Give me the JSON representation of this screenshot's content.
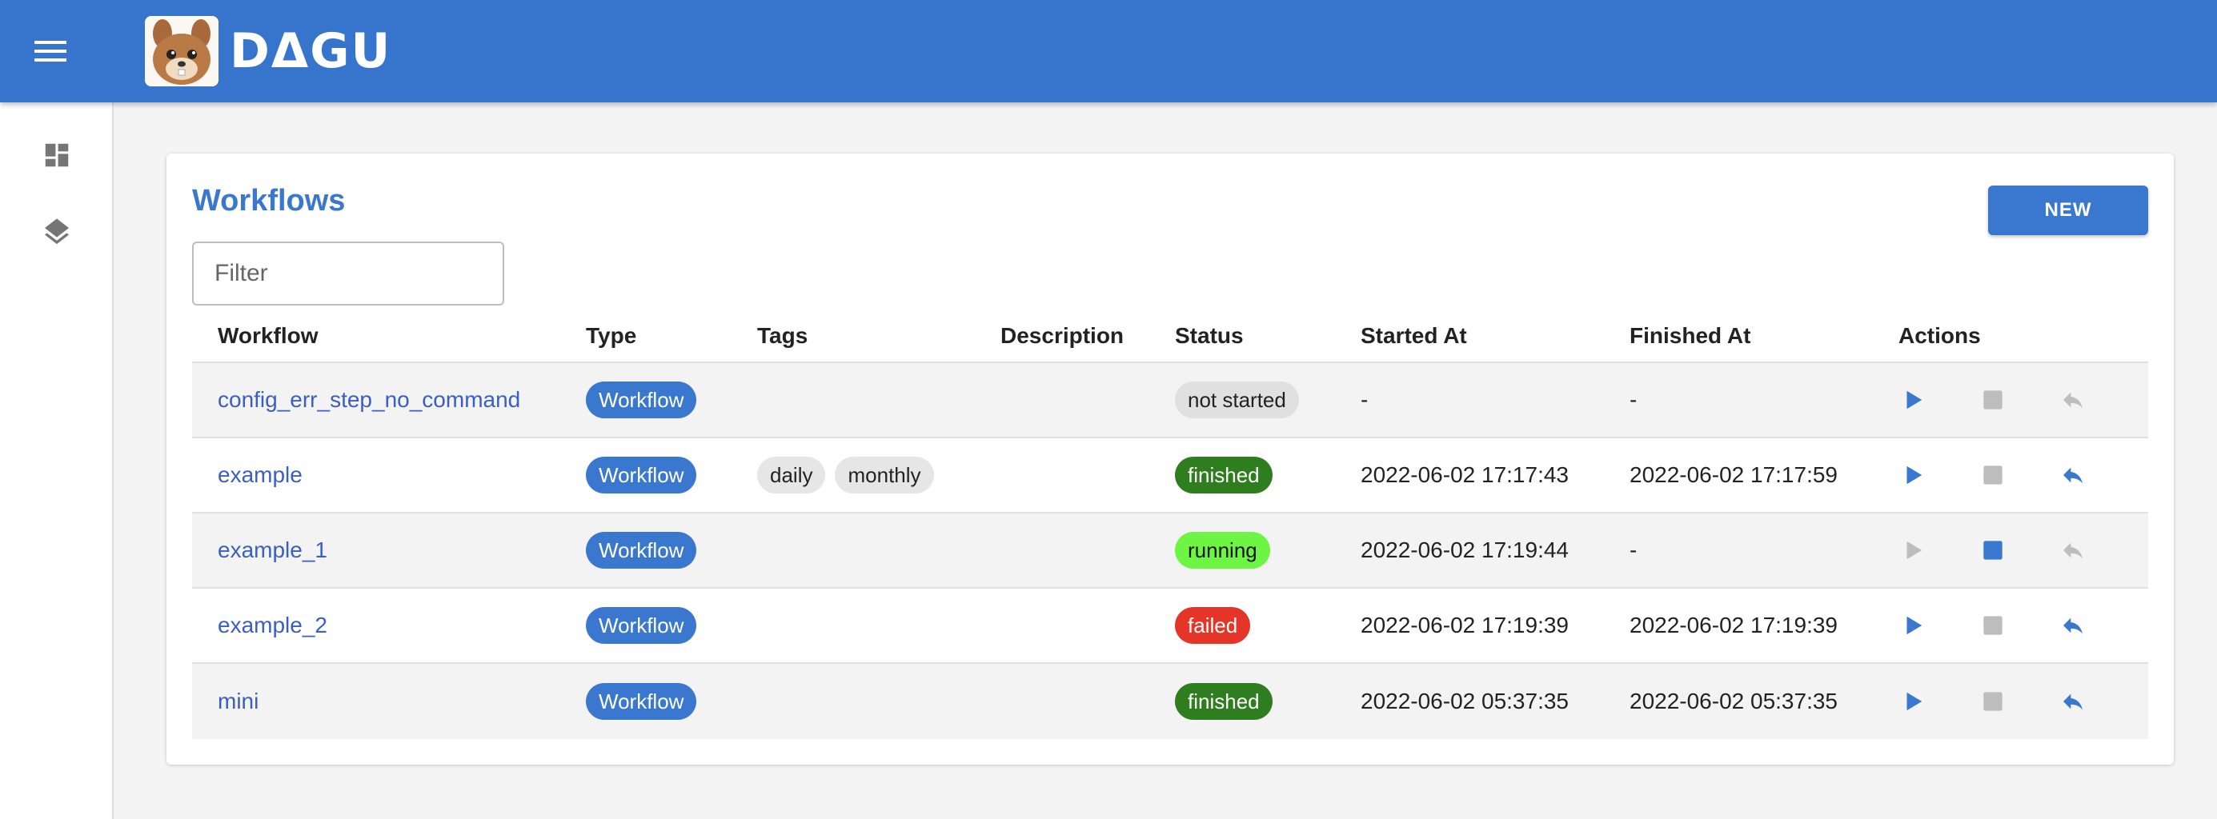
{
  "app": {
    "logo_text": "DΔGU"
  },
  "colors": {
    "primary": "#3775cd",
    "link": "#3b5fc0",
    "icon_enabled": "#3a78cf",
    "icon_disabled": "#bdbdbd",
    "status_not_started": "#e0e0e0",
    "status_finished": "#2e7d1e",
    "status_running": "#6cf542",
    "status_failed": "#e53529"
  },
  "sidebar": {
    "items": [
      {
        "icon": "dashboard-icon"
      },
      {
        "icon": "layers-icon"
      }
    ]
  },
  "main": {
    "title": "Workflows",
    "new_button": "NEW",
    "filter_placeholder": "Filter",
    "filter_value": ""
  },
  "table": {
    "headers": {
      "workflow": "Workflow",
      "type": "Type",
      "tags": "Tags",
      "description": "Description",
      "status": "Status",
      "started_at": "Started At",
      "finished_at": "Finished At",
      "actions": "Actions"
    },
    "rows": [
      {
        "name": "config_err_step_no_command",
        "type": "Workflow",
        "tags": [],
        "description": "",
        "status": "not started",
        "started_at": "-",
        "finished_at": "-",
        "actions": {
          "start": true,
          "stop": false,
          "retry": false
        }
      },
      {
        "name": "example",
        "type": "Workflow",
        "tags": [
          "daily",
          "monthly"
        ],
        "description": "",
        "status": "finished",
        "started_at": "2022-06-02 17:17:43",
        "finished_at": "2022-06-02 17:17:59",
        "actions": {
          "start": true,
          "stop": false,
          "retry": true
        }
      },
      {
        "name": "example_1",
        "type": "Workflow",
        "tags": [],
        "description": "",
        "status": "running",
        "started_at": "2022-06-02 17:19:44",
        "finished_at": "-",
        "actions": {
          "start": false,
          "stop": true,
          "retry": false
        }
      },
      {
        "name": "example_2",
        "type": "Workflow",
        "tags": [],
        "description": "",
        "status": "failed",
        "started_at": "2022-06-02 17:19:39",
        "finished_at": "2022-06-02 17:19:39",
        "actions": {
          "start": true,
          "stop": false,
          "retry": true
        }
      },
      {
        "name": "mini",
        "type": "Workflow",
        "tags": [],
        "description": "",
        "status": "finished",
        "started_at": "2022-06-02 05:37:35",
        "finished_at": "2022-06-02 05:37:35",
        "actions": {
          "start": true,
          "stop": false,
          "retry": true
        }
      }
    ]
  }
}
